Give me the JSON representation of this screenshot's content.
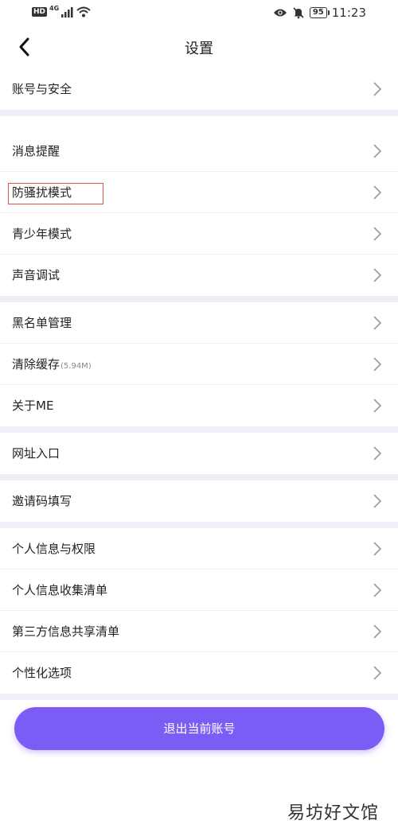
{
  "status_bar": {
    "hd": "HD",
    "network": "4G",
    "battery": "95",
    "time": "11:23",
    "icons": [
      "signal-icon",
      "wifi-icon",
      "eye-icon",
      "bell-off-icon",
      "battery-icon"
    ]
  },
  "nav": {
    "title": "设置",
    "back_icon": "chevron-left-icon"
  },
  "sections": [
    [
      {
        "label": "账号与安全"
      }
    ],
    [
      {
        "label": "消息提醒"
      },
      {
        "label": "防骚扰模式"
      },
      {
        "label": "青少年模式"
      },
      {
        "label": "声音调试"
      }
    ],
    [
      {
        "label": "黑名单管理"
      },
      {
        "label": "清除缓存",
        "sub": "(5.94M)"
      },
      {
        "label": "关于ME"
      }
    ],
    [
      {
        "label": "网址入口"
      }
    ],
    [
      {
        "label": "邀请码填写"
      }
    ],
    [
      {
        "label": "个人信息与权限"
      },
      {
        "label": "个人信息收集清单"
      },
      {
        "label": "第三方信息共享清单"
      },
      {
        "label": "个性化选项"
      }
    ]
  ],
  "logout_label": "退出当前账号",
  "watermark": "易坊好文馆",
  "colors": {
    "accent": "#7b5cf5",
    "divider": "#eef0f5",
    "highlight": "#d9534f"
  }
}
